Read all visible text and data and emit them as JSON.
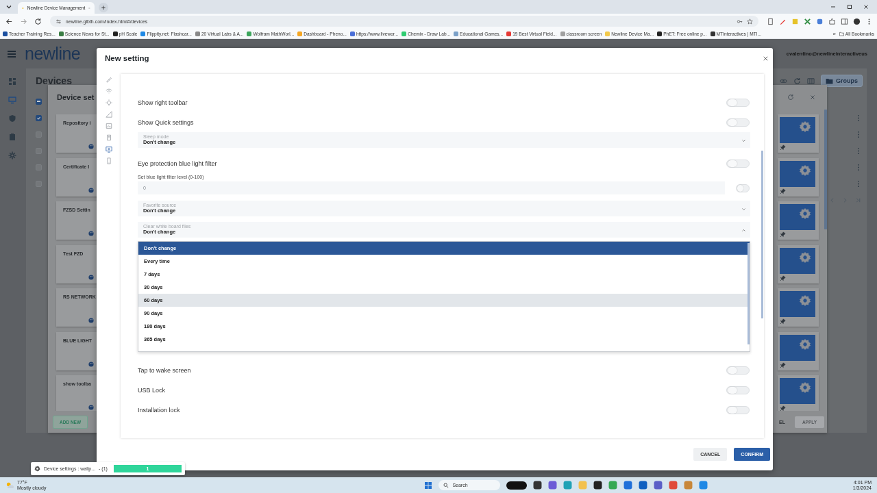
{
  "browser": {
    "tab": {
      "title": "Newline Device Management",
      "selected": true
    },
    "new_tab": "+",
    "url": "newline.glbth.com/index.html#/devices",
    "bookmarks": [
      {
        "label": "Teacher Training Res...",
        "color": "#1a4fa0"
      },
      {
        "label": "Science News for St...",
        "color": "#3a7d44"
      },
      {
        "label": "pH Scale",
        "color": "#222222"
      },
      {
        "label": "Flippity.net: Flashcar...",
        "color": "#1e88e5"
      },
      {
        "label": "20 Virtual Labs & A...",
        "color": "#888888"
      },
      {
        "label": "Wolfram MathWorl...",
        "color": "#3ca55c"
      },
      {
        "label": "Dashboard - Pheno...",
        "color": "#f5a623"
      },
      {
        "label": "https://www.livewor...",
        "color": "#4a6fd8"
      },
      {
        "label": "Chemix - Draw Lab...",
        "color": "#2ecc71"
      },
      {
        "label": "Educational Games...",
        "color": "#7aa0c8"
      },
      {
        "label": "19 Best Virtual Field...",
        "color": "#e53935"
      },
      {
        "label": "classroom screen",
        "color": "#a0a0a0"
      },
      {
        "label": "Newline Device Ma...",
        "color": "#f2c94c"
      },
      {
        "label": "PhET: Free online p...",
        "color": "#222222"
      },
      {
        "label": "MTInteractives | MTI...",
        "color": "#333333"
      }
    ],
    "more_bookmarks": "»",
    "all_bookmarks": "All Bookmarks"
  },
  "app": {
    "logo": "newline",
    "user": "cvalentino@newlineinteractiveus",
    "page_title": "Devices",
    "groups_button": "Groups",
    "table": {
      "select_all_partial": true,
      "rows": [
        {
          "checked": true
        },
        {
          "checked": false
        },
        {
          "checked": false
        },
        {
          "checked": false
        },
        {
          "checked": false
        }
      ]
    },
    "drawer": {
      "title": "Device set",
      "cards": [
        {
          "title": "Repository i"
        },
        {
          "title": "Certificate I"
        },
        {
          "title": "FZSD Settin"
        },
        {
          "title": "Test FZD"
        },
        {
          "title": "RS NETWORK"
        },
        {
          "title": "BLUE LIGHT"
        },
        {
          "title": "show toolba"
        }
      ],
      "add_button": "ADD NEW",
      "cancel_button": "EL",
      "apply_button": {
        "label": "APPLY",
        "disabled": true
      }
    }
  },
  "modal": {
    "title": "New setting",
    "sections": [
      {
        "selected": false
      },
      {
        "selected": false
      },
      {
        "selected": false
      },
      {
        "selected": false
      },
      {
        "selected": false
      },
      {
        "selected": false
      },
      {
        "selected": true
      },
      {
        "selected": false
      }
    ],
    "settings": [
      {
        "kind": "toggle",
        "label": "Show right toolbar",
        "on": false
      },
      {
        "kind": "toggle",
        "label": "Show Quick settings",
        "on": false
      },
      {
        "kind": "select",
        "label": "Sleep mode",
        "value": "Don't change",
        "expanded": false
      },
      {
        "kind": "toggle",
        "label": "Eye protection blue light filter",
        "on": false
      },
      {
        "kind": "number",
        "label": "Set blue light filter level (0-100)",
        "placeholder": "0",
        "on": false
      },
      {
        "kind": "select",
        "label": "Favorite source",
        "value": "Don't change",
        "expanded": false
      },
      {
        "kind": "select",
        "label": "Clear white board files",
        "value": "Don't change",
        "expanded": true,
        "options": [
          {
            "label": "Don't change",
            "selected": true,
            "hovered": false
          },
          {
            "label": "Every time",
            "selected": false,
            "hovered": false
          },
          {
            "label": "7 days",
            "selected": false,
            "hovered": false
          },
          {
            "label": "30 days",
            "selected": false,
            "hovered": false
          },
          {
            "label": "60 days",
            "selected": false,
            "hovered": true
          },
          {
            "label": "90 days",
            "selected": false,
            "hovered": false
          },
          {
            "label": "180 days",
            "selected": false,
            "hovered": false
          },
          {
            "label": "365 days",
            "selected": false,
            "hovered": false
          }
        ]
      },
      {
        "kind": "toggle",
        "label": "Tap to wake screen",
        "on": false
      },
      {
        "kind": "toggle",
        "label": "USB Lock",
        "on": false
      },
      {
        "kind": "toggle",
        "label": "Installation lock",
        "on": false
      }
    ],
    "cancel": "CANCEL",
    "confirm": "CONFIRM"
  },
  "toast": {
    "label": "Device settings : wallp...",
    "count": "- (1)",
    "progress": {
      "level": 1,
      "text": "1"
    }
  },
  "taskbar": {
    "temperature": "77°F",
    "condition": "Mostly cloudy",
    "search": "Search",
    "apps": [
      {
        "color": "#111111"
      },
      {
        "color": "#333333"
      },
      {
        "color": "#6b5bd6"
      },
      {
        "color": "#1fa2b5"
      },
      {
        "color": "#f2c14e"
      },
      {
        "color": "#222222"
      },
      {
        "color": "#34a853"
      },
      {
        "color": "#1e6fd9"
      },
      {
        "color": "#0f5fc0"
      },
      {
        "color": "#5b5fc7"
      },
      {
        "color": "#e04a3a"
      },
      {
        "color": "#c8873a"
      },
      {
        "color": "#1e88e5"
      }
    ],
    "time": "4:01 PM",
    "date": "1/3/2024"
  }
}
